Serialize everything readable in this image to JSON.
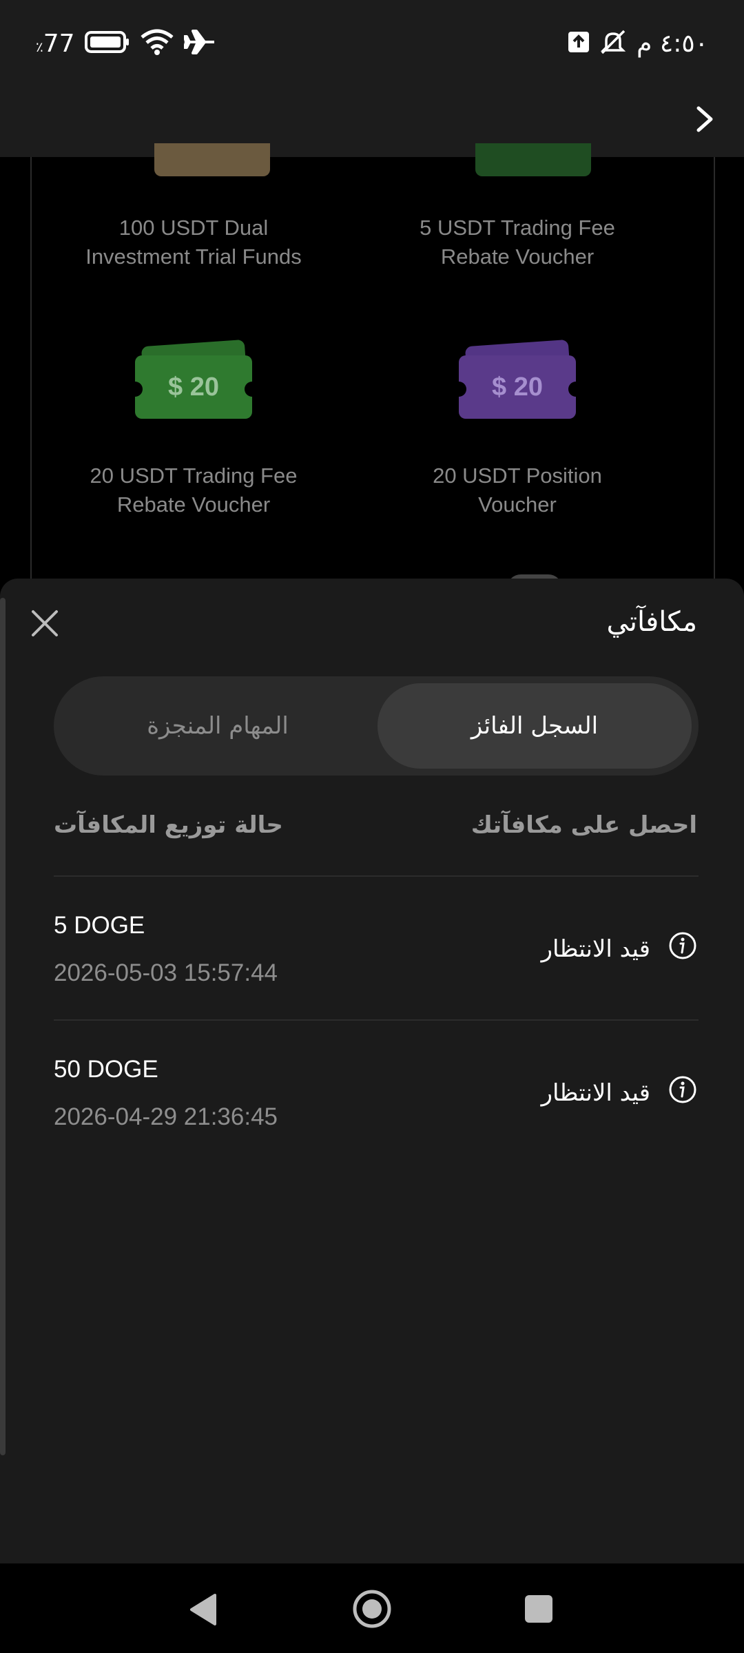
{
  "status_bar": {
    "battery": "77",
    "battery_percent_sign": "٪",
    "time": "٤:٥٠ م"
  },
  "vouchers": [
    {
      "label": "100 USDT Dual Investment Trial Funds",
      "color": "#6b5a3f"
    },
    {
      "label": "5 USDT Trading Fee Rebate Voucher",
      "color": "#1f5a25"
    },
    {
      "label": "20 USDT Trading Fee Rebate Voucher",
      "amount": "$ 20",
      "color": "#2f7a2f"
    },
    {
      "label": "20 USDT Position Voucher",
      "amount": "$ 20",
      "color": "#5a3a8a"
    }
  ],
  "sheet": {
    "title": "مكافآتي",
    "tabs": {
      "active": "السجل الفائز",
      "inactive": "المهام المنجزة"
    },
    "columns": {
      "right": "احصل على مكافآتك",
      "left": "حالة توزيع المكافآت"
    },
    "rows": [
      {
        "amount": "5 DOGE",
        "date": "2026-05-03 15:57:44",
        "status": "قيد الانتظار"
      },
      {
        "amount": "50 DOGE",
        "date": "2026-04-29 21:36:45",
        "status": "قيد الانتظار"
      }
    ]
  }
}
